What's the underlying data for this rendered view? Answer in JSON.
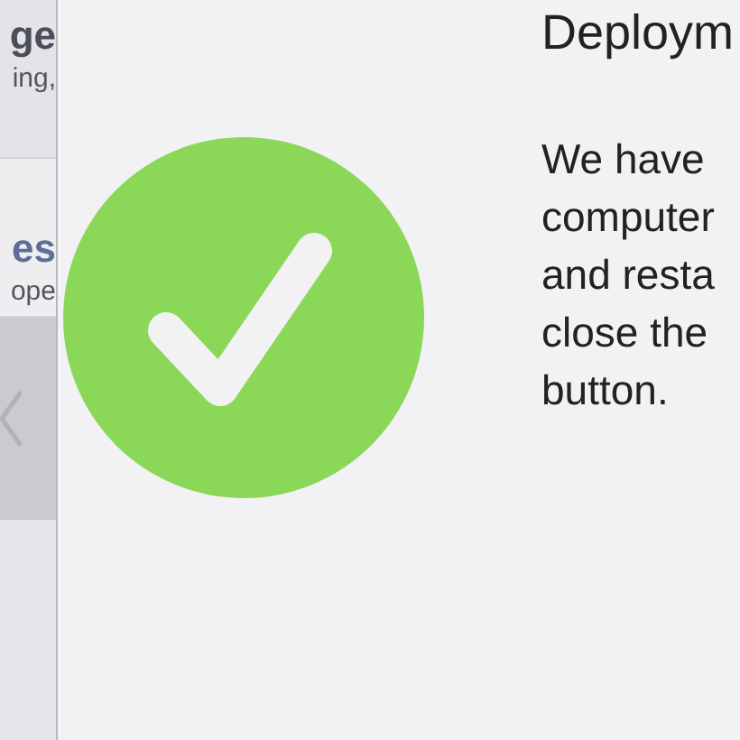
{
  "sidebar": {
    "items": [
      {
        "title": "ge",
        "subtitle": "ing,",
        "selected": false
      },
      {
        "title": "es",
        "subtitle": "ope",
        "selected": true
      }
    ]
  },
  "main": {
    "status": {
      "kind": "success"
    },
    "title": "Deploym",
    "body_lines": [
      "We have",
      "computer",
      "and resta",
      "close the",
      "button."
    ]
  }
}
